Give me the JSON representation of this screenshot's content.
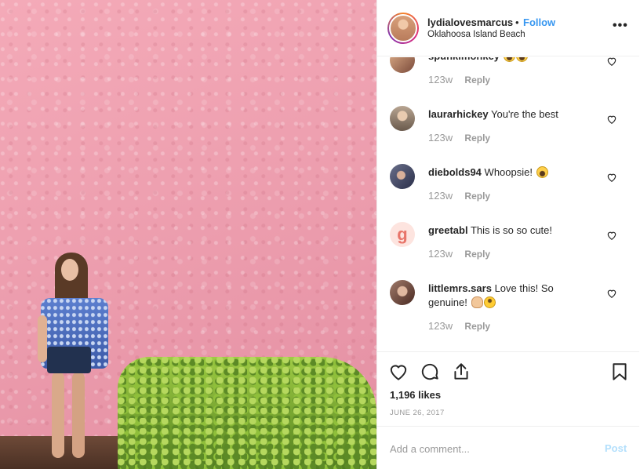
{
  "post": {
    "username": "lydialovesmarcus",
    "separator": "•",
    "follow_label": "Follow",
    "location": "Oklahoosa Island Beach",
    "more_icon": "more-horizontal-icon"
  },
  "comments": [
    {
      "user": "spunkimonkey",
      "text": "",
      "emojis": [
        "laugh",
        "laugh"
      ],
      "time": "123w",
      "reply": "Reply",
      "avatar_color": "#c98a6a"
    },
    {
      "user": "laurarhickey",
      "text": "You're the best",
      "emojis": [],
      "time": "123w",
      "reply": "Reply",
      "avatar_color": "#8c7a6a"
    },
    {
      "user": "diebolds94",
      "text": "Whoopsie!",
      "emojis": [
        "laugh"
      ],
      "time": "123w",
      "reply": "Reply",
      "avatar_color": "#4a4f6a"
    },
    {
      "user": "greetabl",
      "text": "This is so so cute!",
      "emojis": [],
      "time": "123w",
      "reply": "Reply",
      "avatar_color": "#fde0dc",
      "avatar_letter": "g"
    },
    {
      "user": "littlemrs.sars",
      "text": "Love this! So genuine!",
      "emojis": [
        "ok",
        "upside"
      ],
      "time": "123w",
      "reply": "Reply",
      "avatar_color": "#7a5a4a"
    }
  ],
  "actions": {
    "like_icon": "heart-icon",
    "comment_icon": "comment-icon",
    "share_icon": "share-icon",
    "save_icon": "bookmark-icon",
    "likes": "1,196 likes",
    "date": "JUNE 26, 2017"
  },
  "add_comment": {
    "placeholder": "Add a comment...",
    "post_label": "Post"
  },
  "colors": {
    "accent": "#3897f0",
    "post_disabled": "#b2dffc",
    "muted": "#999999"
  }
}
